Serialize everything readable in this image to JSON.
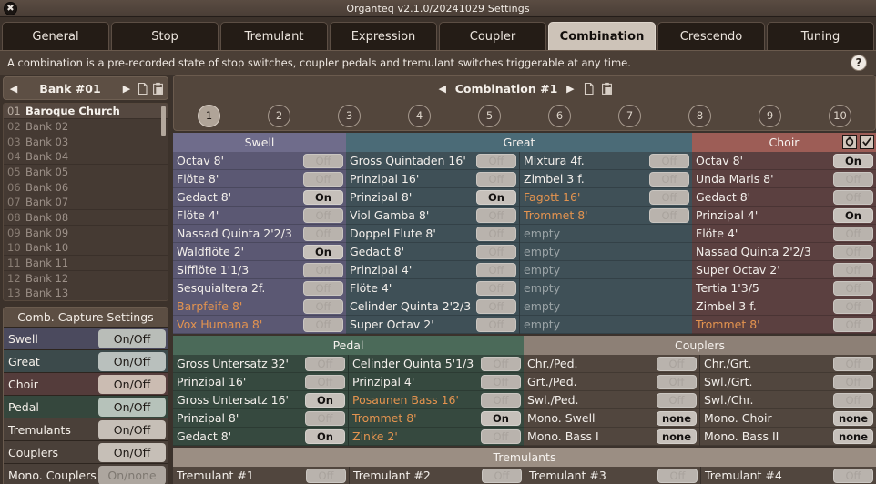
{
  "window": {
    "title": "Organteq v2.1.0/20241029 Settings",
    "close_icon": "close-icon"
  },
  "tabs": [
    {
      "label": "General",
      "active": false
    },
    {
      "label": "Stop",
      "active": false
    },
    {
      "label": "Tremulant",
      "active": false
    },
    {
      "label": "Expression",
      "active": false
    },
    {
      "label": "Coupler",
      "active": false
    },
    {
      "label": "Combination",
      "active": true
    },
    {
      "label": "Crescendo",
      "active": false
    },
    {
      "label": "Tuning",
      "active": false
    }
  ],
  "info": {
    "message": "A combination is a pre-recorded state of stop switches, coupler pedals and tremulant switches triggerable at any time.",
    "help_label": "?"
  },
  "bank_panel": {
    "prev_label": "◀",
    "next_label": "▶",
    "current": "Bank #01",
    "copy_icon": "copy-icon",
    "paste_icon": "paste-icon",
    "items": [
      {
        "num": "01",
        "name": "Baroque Church",
        "selected": true
      },
      {
        "num": "02",
        "name": "Bank 02",
        "selected": false
      },
      {
        "num": "03",
        "name": "Bank 03",
        "selected": false
      },
      {
        "num": "04",
        "name": "Bank 04",
        "selected": false
      },
      {
        "num": "05",
        "name": "Bank 05",
        "selected": false
      },
      {
        "num": "06",
        "name": "Bank 06",
        "selected": false
      },
      {
        "num": "07",
        "name": "Bank 07",
        "selected": false
      },
      {
        "num": "08",
        "name": "Bank 08",
        "selected": false
      },
      {
        "num": "09",
        "name": "Bank 09",
        "selected": false
      },
      {
        "num": "10",
        "name": "Bank 10",
        "selected": false
      },
      {
        "num": "11",
        "name": "Bank 11",
        "selected": false
      },
      {
        "num": "12",
        "name": "Bank 12",
        "selected": false
      },
      {
        "num": "13",
        "name": "Bank 13",
        "selected": false
      }
    ]
  },
  "capture_settings": {
    "title": "Comb. Capture Settings",
    "rows": [
      {
        "label": "Swell",
        "value": "On/Off",
        "row_color": "#4b4a5e",
        "btn_color": "#b9bdb8",
        "dim": false
      },
      {
        "label": "Great",
        "value": "On/Off",
        "row_color": "#3c4a4b",
        "btn_color": "#b9c0bd",
        "dim": false
      },
      {
        "label": "Choir",
        "value": "On/Off",
        "row_color": "#543c3b",
        "btn_color": "#cbbcb2",
        "dim": false
      },
      {
        "label": "Pedal",
        "value": "On/Off",
        "row_color": "#35473d",
        "btn_color": "#b6c2ba",
        "dim": false
      },
      {
        "label": "Tremulants",
        "value": "On/Off",
        "row_color": "#4a4039",
        "btn_color": "#c6bfb7",
        "dim": false
      },
      {
        "label": "Couplers",
        "value": "On/Off",
        "row_color": "#4a4039",
        "btn_color": "#c6bfb7",
        "dim": false
      },
      {
        "label": "Mono. Couplers",
        "value": "On/none",
        "row_color": "#4a4039",
        "btn_color": "#ada69f",
        "dim": true
      }
    ]
  },
  "combination": {
    "prev_label": "◀",
    "next_label": "▶",
    "title": "Combination #1",
    "copy_icon": "copy-icon",
    "paste_icon": "paste-icon",
    "numbers": [
      {
        "label": "1",
        "selected": true
      },
      {
        "label": "2",
        "selected": false
      },
      {
        "label": "3",
        "selected": false
      },
      {
        "label": "4",
        "selected": false
      },
      {
        "label": "5",
        "selected": false
      },
      {
        "label": "6",
        "selected": false
      },
      {
        "label": "7",
        "selected": false
      },
      {
        "label": "8",
        "selected": false
      },
      {
        "label": "9",
        "selected": false
      },
      {
        "label": "10",
        "selected": false
      }
    ]
  },
  "divisions": {
    "swell": {
      "title": "Swell",
      "stops": [
        {
          "label": "Octav 8'",
          "state": "Off",
          "reed": false
        },
        {
          "label": "Flöte 8'",
          "state": "Off",
          "reed": false
        },
        {
          "label": "Gedact 8'",
          "state": "On",
          "reed": false
        },
        {
          "label": "Flöte 4'",
          "state": "Off",
          "reed": false
        },
        {
          "label": "Nassad Quinta 2'2/3",
          "state": "Off",
          "reed": false
        },
        {
          "label": "Waldflöte 2'",
          "state": "On",
          "reed": false
        },
        {
          "label": "Sifflöte 1'1/3",
          "state": "Off",
          "reed": false
        },
        {
          "label": "Sesquialtera 2f.",
          "state": "Off",
          "reed": false
        },
        {
          "label": "Barpfeife 8'",
          "state": "Off",
          "reed": true
        },
        {
          "label": "Vox Humana 8'",
          "state": "Off",
          "reed": true
        }
      ]
    },
    "great": {
      "title": "Great",
      "col1": [
        {
          "label": "Gross Quintaden 16'",
          "state": "Off",
          "reed": false
        },
        {
          "label": "Prinzipal 16'",
          "state": "Off",
          "reed": false
        },
        {
          "label": "Prinzipal 8'",
          "state": "On",
          "reed": false
        },
        {
          "label": "Viol Gamba 8'",
          "state": "Off",
          "reed": false
        },
        {
          "label": "Doppel Flute 8'",
          "state": "Off",
          "reed": false
        },
        {
          "label": "Gedact 8'",
          "state": "Off",
          "reed": false
        },
        {
          "label": "Prinzipal 4'",
          "state": "Off",
          "reed": false
        },
        {
          "label": "Flöte 4'",
          "state": "Off",
          "reed": false
        },
        {
          "label": "Celinder Quinta 2'2/3",
          "state": "Off",
          "reed": false
        },
        {
          "label": "Super Octav 2'",
          "state": "Off",
          "reed": false
        }
      ],
      "col2": [
        {
          "label": "Mixtura 4f.",
          "state": "Off",
          "reed": false,
          "empty": false
        },
        {
          "label": "Zimbel 3 f.",
          "state": "Off",
          "reed": false,
          "empty": false
        },
        {
          "label": "Fagott 16'",
          "state": "Off",
          "reed": true,
          "empty": false
        },
        {
          "label": "Trommet 8'",
          "state": "Off",
          "reed": true,
          "empty": false
        },
        {
          "label": "empty",
          "state": "",
          "reed": false,
          "empty": true
        },
        {
          "label": "empty",
          "state": "",
          "reed": false,
          "empty": true
        },
        {
          "label": "empty",
          "state": "",
          "reed": false,
          "empty": true
        },
        {
          "label": "empty",
          "state": "",
          "reed": false,
          "empty": true
        },
        {
          "label": "empty",
          "state": "",
          "reed": false,
          "empty": true
        },
        {
          "label": "empty",
          "state": "",
          "reed": false,
          "empty": true
        }
      ]
    },
    "choir": {
      "title": "Choir",
      "record_icon": "record-icon",
      "check_icon": "checkbox-checked-icon",
      "stops": [
        {
          "label": "Octav 8'",
          "state": "On",
          "reed": false
        },
        {
          "label": "Unda Maris 8'",
          "state": "Off",
          "reed": false
        },
        {
          "label": "Gedact 8'",
          "state": "Off",
          "reed": false
        },
        {
          "label": "Prinzipal 4'",
          "state": "On",
          "reed": false
        },
        {
          "label": "Flöte 4'",
          "state": "Off",
          "reed": false
        },
        {
          "label": "Nassad Quinta 2'2/3",
          "state": "Off",
          "reed": false
        },
        {
          "label": "Super Octav 2'",
          "state": "Off",
          "reed": false
        },
        {
          "label": "Tertia 1'3/5",
          "state": "Off",
          "reed": false
        },
        {
          "label": "Zimbel 3 f.",
          "state": "Off",
          "reed": false
        },
        {
          "label": "Trommet 8'",
          "state": "Off",
          "reed": true
        }
      ]
    },
    "pedal": {
      "title": "Pedal",
      "col1": [
        {
          "label": "Gross Untersatz 32'",
          "state": "Off",
          "reed": false
        },
        {
          "label": "Prinzipal 16'",
          "state": "Off",
          "reed": false
        },
        {
          "label": "Gross Untersatz 16'",
          "state": "On",
          "reed": false
        },
        {
          "label": "Prinzipal 8'",
          "state": "Off",
          "reed": false
        },
        {
          "label": "Gedact 8'",
          "state": "On",
          "reed": false
        }
      ],
      "col2": [
        {
          "label": "Celinder Quinta 5'1/3",
          "state": "Off",
          "reed": false
        },
        {
          "label": "Prinzipal 4'",
          "state": "Off",
          "reed": false
        },
        {
          "label": "Posaunen Bass 16'",
          "state": "Off",
          "reed": true
        },
        {
          "label": "Trommet 8'",
          "state": "On",
          "reed": true
        },
        {
          "label": "Zinke 2'",
          "state": "Off",
          "reed": true
        }
      ]
    },
    "couplers": {
      "title": "Couplers",
      "col1": [
        {
          "label": "Chr./Ped.",
          "state": "Off"
        },
        {
          "label": "Grt./Ped.",
          "state": "Off"
        },
        {
          "label": "Swl./Ped.",
          "state": "Off"
        },
        {
          "label": "Mono. Swell",
          "state": "none"
        },
        {
          "label": "Mono. Bass I",
          "state": "none"
        }
      ],
      "col2": [
        {
          "label": "Chr./Grt.",
          "state": "Off"
        },
        {
          "label": "Swl./Grt.",
          "state": "Off"
        },
        {
          "label": "Swl./Chr.",
          "state": "Off"
        },
        {
          "label": "Mono. Choir",
          "state": "none"
        },
        {
          "label": "Mono. Bass II",
          "state": "none"
        }
      ]
    },
    "tremulants": {
      "title": "Tremulants",
      "items": [
        {
          "label": "Tremulant #1",
          "state": "Off"
        },
        {
          "label": "Tremulant #2",
          "state": "Off"
        },
        {
          "label": "Tremulant #3",
          "state": "Off"
        },
        {
          "label": "Tremulant #4",
          "state": "Off"
        }
      ]
    }
  }
}
